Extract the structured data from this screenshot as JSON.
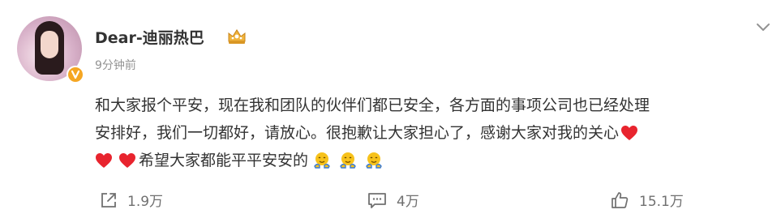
{
  "post": {
    "author": "Dear-迪丽热巴",
    "time": "9分钟前",
    "text_line1": "和大家报个平安，现在我和团队的伙伴们都已安全，各方面的事项公司也已经处理",
    "text_line2": "安排好，我们一切都好，请放心。很抱歉让大家担心了，感谢大家对我的关心",
    "text_line3": "希望大家都能平平安安的",
    "icons": {
      "verified": "verified-badge-icon",
      "name_badge": "crown-badge-icon",
      "more": "chevron-down-icon",
      "heart": "red-heart-emoji",
      "hug": "hug-emoji"
    }
  },
  "actions": {
    "repost_count": "1.9万",
    "comment_count": "4万",
    "like_count": "15.1万"
  },
  "colors": {
    "text": "#333333",
    "muted": "#939393",
    "heart": "#e8242e",
    "verified": "#f5a623",
    "action": "#707070"
  }
}
